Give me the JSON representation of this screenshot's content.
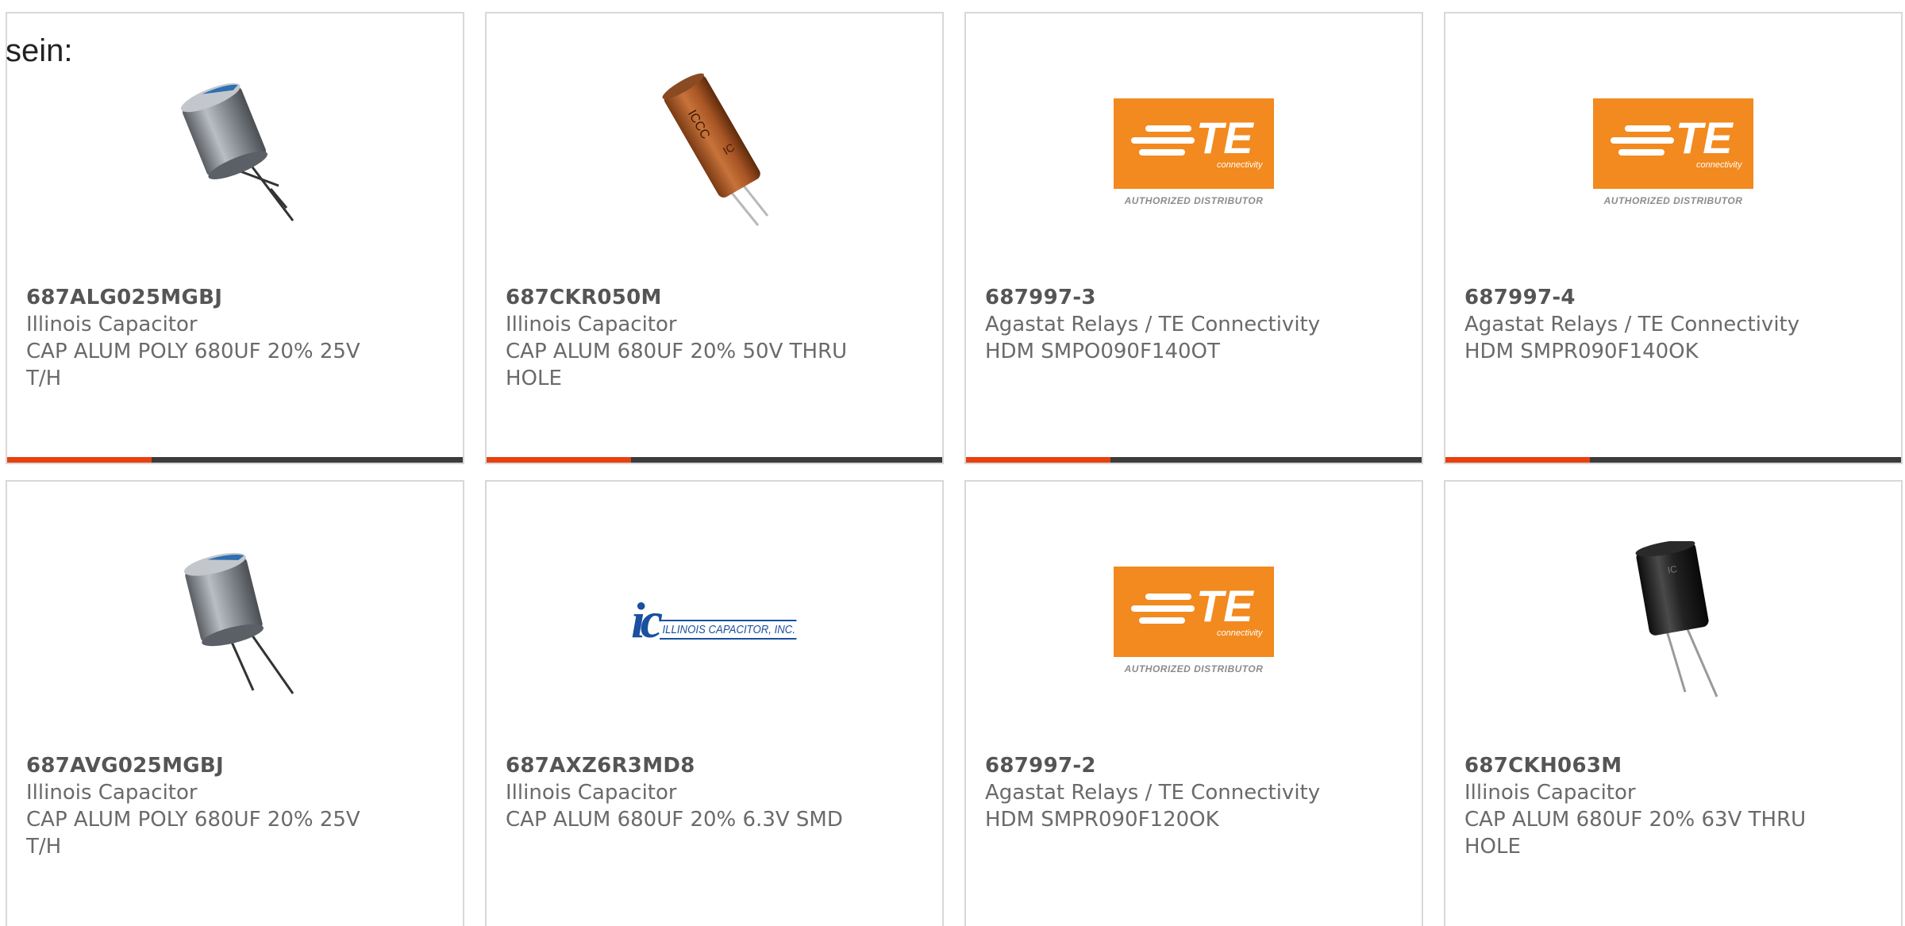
{
  "intro_text": "sein:",
  "te_logo": {
    "word": "TE",
    "sub": "connectivity",
    "tagline": "AUTHORIZED DISTRIBUTOR",
    "color": "#f28a1f"
  },
  "ic_logo": {
    "mark": "ic",
    "text": "ILLINOIS CAPACITOR, INC.",
    "color": "#1b4f9f"
  },
  "accent_color": "#e8410f",
  "products": [
    {
      "part_number": "687ALG025MGBJ",
      "manufacturer": "Illinois Capacitor",
      "description": "CAP ALUM POLY 680UF 20% 25V T/H",
      "image": "gray-polymer-capacitor-icon"
    },
    {
      "part_number": "687CKR050M",
      "manufacturer": "Illinois Capacitor",
      "description": "CAP ALUM 680UF 20% 50V THRU HOLE",
      "image": "orange-electrolytic-capacitor-icon"
    },
    {
      "part_number": "687997-3",
      "manufacturer": "Agastat Relays / TE Connectivity",
      "description": "HDM SMPO090F140OT",
      "image": "te-connectivity-logo"
    },
    {
      "part_number": "687997-4",
      "manufacturer": "Agastat Relays / TE Connectivity",
      "description": "HDM SMPR090F140OK",
      "image": "te-connectivity-logo"
    },
    {
      "part_number": "687AVG025MGBJ",
      "manufacturer": "Illinois Capacitor",
      "description": "CAP ALUM POLY 680UF 20% 25V T/H",
      "image": "gray-polymer-capacitor-icon"
    },
    {
      "part_number": "687AXZ6R3MD8",
      "manufacturer": "Illinois Capacitor",
      "description": "CAP ALUM 680UF 20% 6.3V SMD",
      "image": "illinois-capacitor-logo"
    },
    {
      "part_number": "687997-2",
      "manufacturer": "Agastat Relays / TE Connectivity",
      "description": "HDM SMPR090F120OK",
      "image": "te-connectivity-logo"
    },
    {
      "part_number": "687CKH063M",
      "manufacturer": "Illinois Capacitor",
      "description": "CAP ALUM 680UF 20% 63V THRU HOLE",
      "image": "black-electrolytic-capacitor-icon"
    }
  ]
}
